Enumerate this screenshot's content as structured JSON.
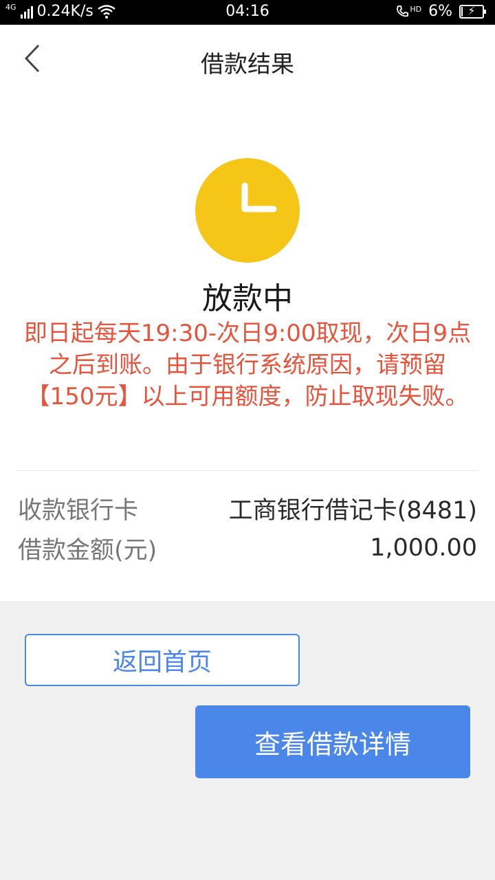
{
  "status_bar": {
    "network": "4G",
    "speed": "0.24K/s",
    "time": "04:16",
    "call_badge": "HD",
    "battery": "6%"
  },
  "header": {
    "title": "借款结果"
  },
  "result": {
    "status": "放款中",
    "notice": "即日起每天19:30-次日9:00取现，次日9点之后到账。由于银行系统原因，请预留【150元】以上可用额度，防止取现失败。"
  },
  "details": [
    {
      "label": "收款银行卡",
      "value": "工商银行借记卡(8481)"
    },
    {
      "label": "借款金额(元)",
      "value": "1,000.00"
    }
  ],
  "buttons": {
    "home": "返回首页",
    "detail": "查看借款详情"
  },
  "colors": {
    "accent": "#4a87e8",
    "warning": "#e8533b",
    "clock": "#f5c518"
  }
}
